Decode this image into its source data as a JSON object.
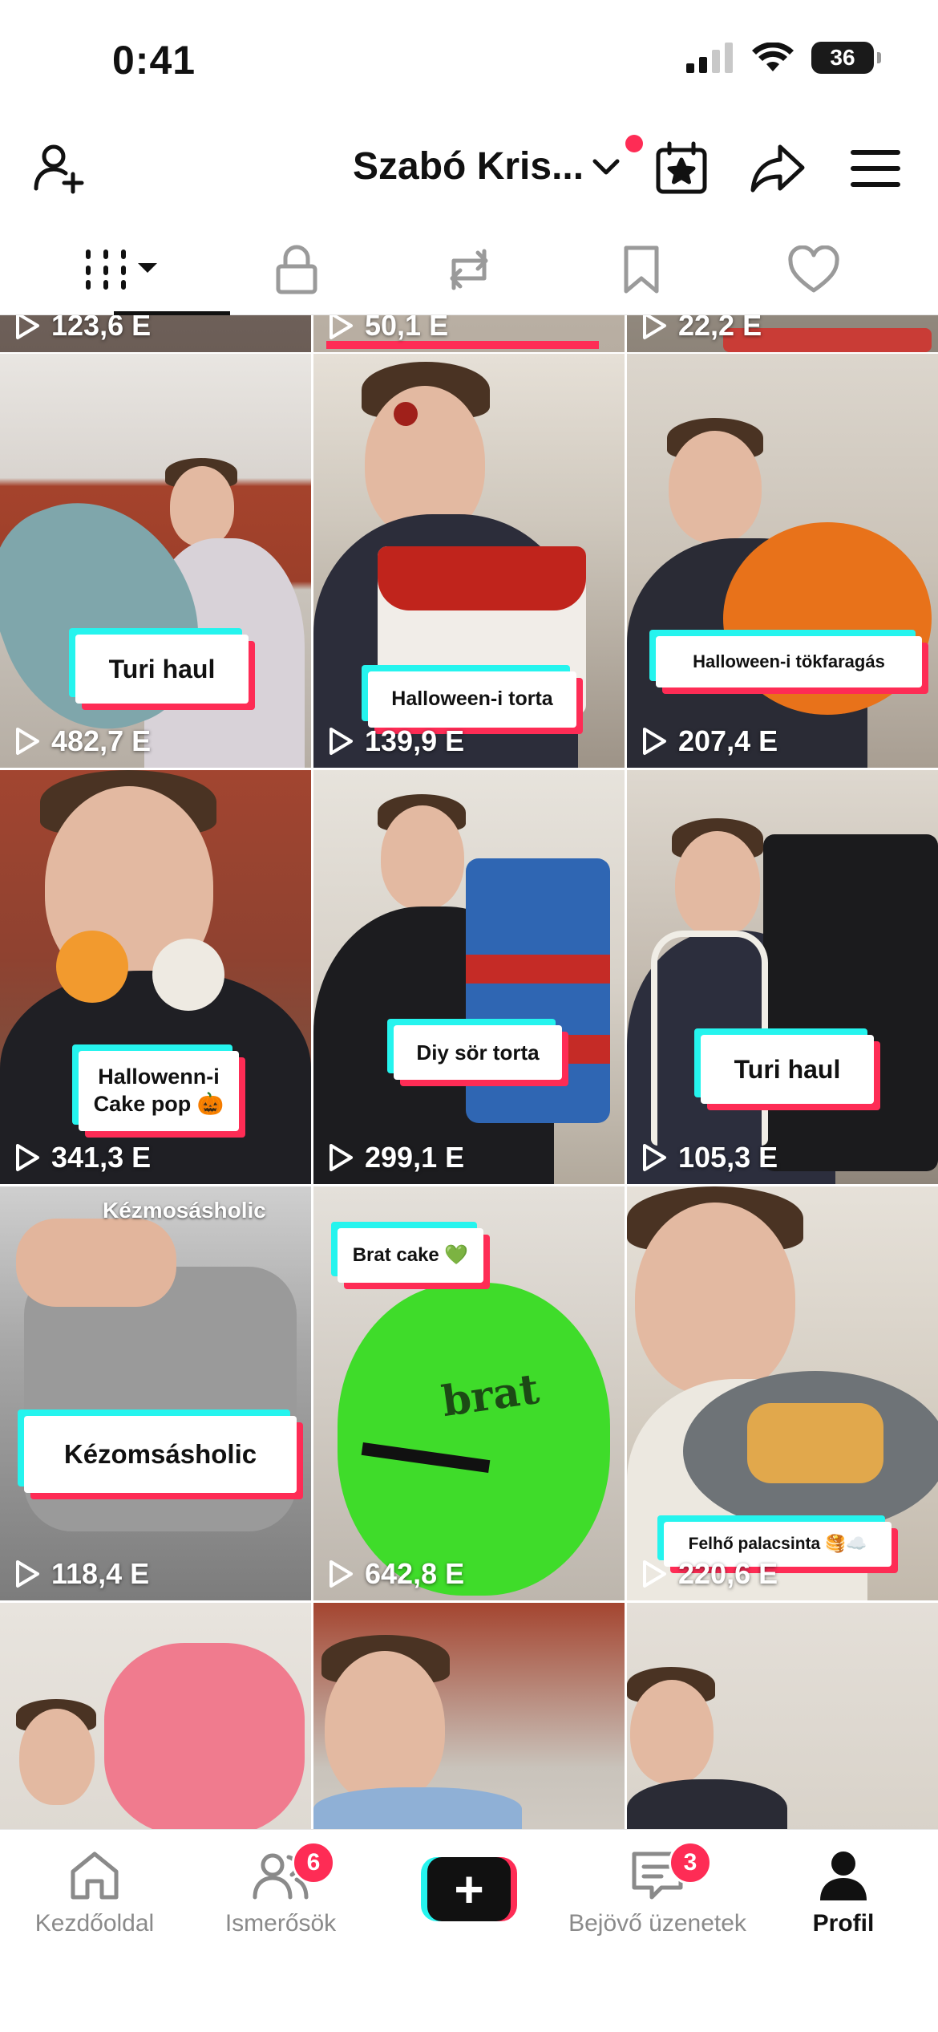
{
  "status_bar": {
    "time": "0:41",
    "battery": "36"
  },
  "header": {
    "username": "Szabó Kris..."
  },
  "profile_tabs": [
    "videos-grid",
    "private",
    "reposts",
    "favorites",
    "liked"
  ],
  "videos": [
    {
      "views": "123,6 E",
      "caption": ""
    },
    {
      "views": "50,1 E",
      "caption": ""
    },
    {
      "views": "22,2 E",
      "caption": ""
    },
    {
      "views": "482,7 E",
      "caption": "Turi haul"
    },
    {
      "views": "139,9 E",
      "caption": "Halloween-i torta"
    },
    {
      "views": "207,4 E",
      "caption": "Halloween-i tökfaragás"
    },
    {
      "views": "341,3 E",
      "caption_line1": "Hallowenn-i",
      "caption_line2": "Cake pop 🎃"
    },
    {
      "views": "299,1 E",
      "caption": "Diy sör torta"
    },
    {
      "views": "105,3 E",
      "caption": "Turi haul"
    },
    {
      "views": "118,4 E",
      "caption": "Kézomsásholic",
      "top_text": "Kézmosásholic"
    },
    {
      "views": "642,8 E",
      "caption": "Brat cake 💚",
      "cake_text": "brat"
    },
    {
      "views": "220,6 E",
      "caption": "Felhő palacsinta 🥞☁️"
    }
  ],
  "tab_bar": {
    "home": "Kezdőoldal",
    "friends": "Ismerősök",
    "friends_badge": "6",
    "create": "+",
    "inbox": "Bejövő üzenetek",
    "inbox_badge": "3",
    "profile": "Profil"
  },
  "colors": {
    "accent_red": "#fe2c55",
    "accent_cyan": "#25f4ee",
    "text": "#111111",
    "muted": "#8a8a8a"
  }
}
